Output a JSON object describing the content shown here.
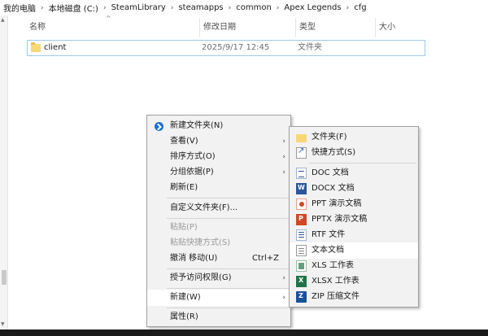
{
  "breadcrumb": [
    "我的电脑",
    "本地磁盘 (C:)",
    "SteamLibrary",
    "steamapps",
    "common",
    "Apex Legends",
    "cfg"
  ],
  "columns": {
    "name": "名称",
    "modified": "修改日期",
    "type": "类型",
    "size": "大小"
  },
  "file": {
    "name": "client",
    "modified": "2025/9/17 12:45",
    "type": "文件夹"
  },
  "context_menu": {
    "new_folder": "新建文件夹(N)",
    "view": "查看(V)",
    "sort_by": "排序方式(O)",
    "group_by": "分组依据(P)",
    "refresh": "刷新(E)",
    "customize_folder": "自定义文件夹(F)...",
    "paste": "粘贴(P)",
    "paste_shortcut": "粘贴快捷方式(S)",
    "undo_move": "撤消 移动(U)",
    "undo_shortcut": "Ctrl+Z",
    "give_access": "授予访问权限(G)",
    "new": "新建(W)",
    "properties": "属性(R)"
  },
  "new_submenu": {
    "folder": "文件夹(F)",
    "shortcut": "快捷方式(S)",
    "doc": "DOC 文档",
    "docx": "DOCX 文档",
    "ppt": "PPT 演示文稿",
    "pptx": "PPTX 演示文稿",
    "rtf": "RTF 文件",
    "txt": "文本文档",
    "xls": "XLS 工作表",
    "xlsx": "XLSX 工作表",
    "zip": "ZIP 压缩文件"
  },
  "colors": {
    "selection_border": "#99c9ef",
    "folder": "#f8d775",
    "menu_bg": "#f2f2f2"
  }
}
